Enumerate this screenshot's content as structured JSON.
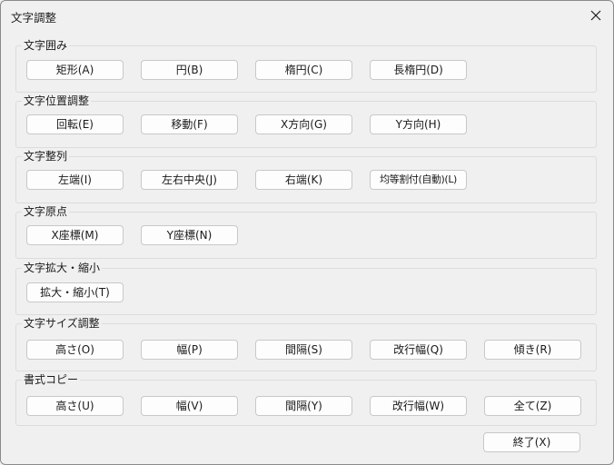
{
  "window": {
    "title": "文字調整",
    "close_icon": "close-icon"
  },
  "groups": [
    {
      "label": "文字囲み",
      "buttons": [
        "矩形(A)",
        "円(B)",
        "楕円(C)",
        "長楕円(D)"
      ]
    },
    {
      "label": "文字位置調整",
      "buttons": [
        "回転(E)",
        "移動(F)",
        "X方向(G)",
        "Y方向(H)"
      ]
    },
    {
      "label": "文字整列",
      "buttons": [
        "左端(I)",
        "左右中央(J)",
        "右端(K)",
        "均等割付(自動)(L)"
      ]
    },
    {
      "label": "文字原点",
      "buttons": [
        "X座標(M)",
        "Y座標(N)"
      ]
    },
    {
      "label": "文字拡大・縮小",
      "buttons": [
        "拡大・縮小(T)"
      ]
    },
    {
      "label": "文字サイズ調整",
      "buttons": [
        "高さ(O)",
        "幅(P)",
        "間隔(S)",
        "改行幅(Q)",
        "傾き(R)"
      ]
    },
    {
      "label": "書式コピー",
      "buttons": [
        "高さ(U)",
        "幅(V)",
        "間隔(Y)",
        "改行幅(W)",
        "全て(Z)"
      ]
    }
  ],
  "footer": {
    "close_label": "終了(X)"
  }
}
